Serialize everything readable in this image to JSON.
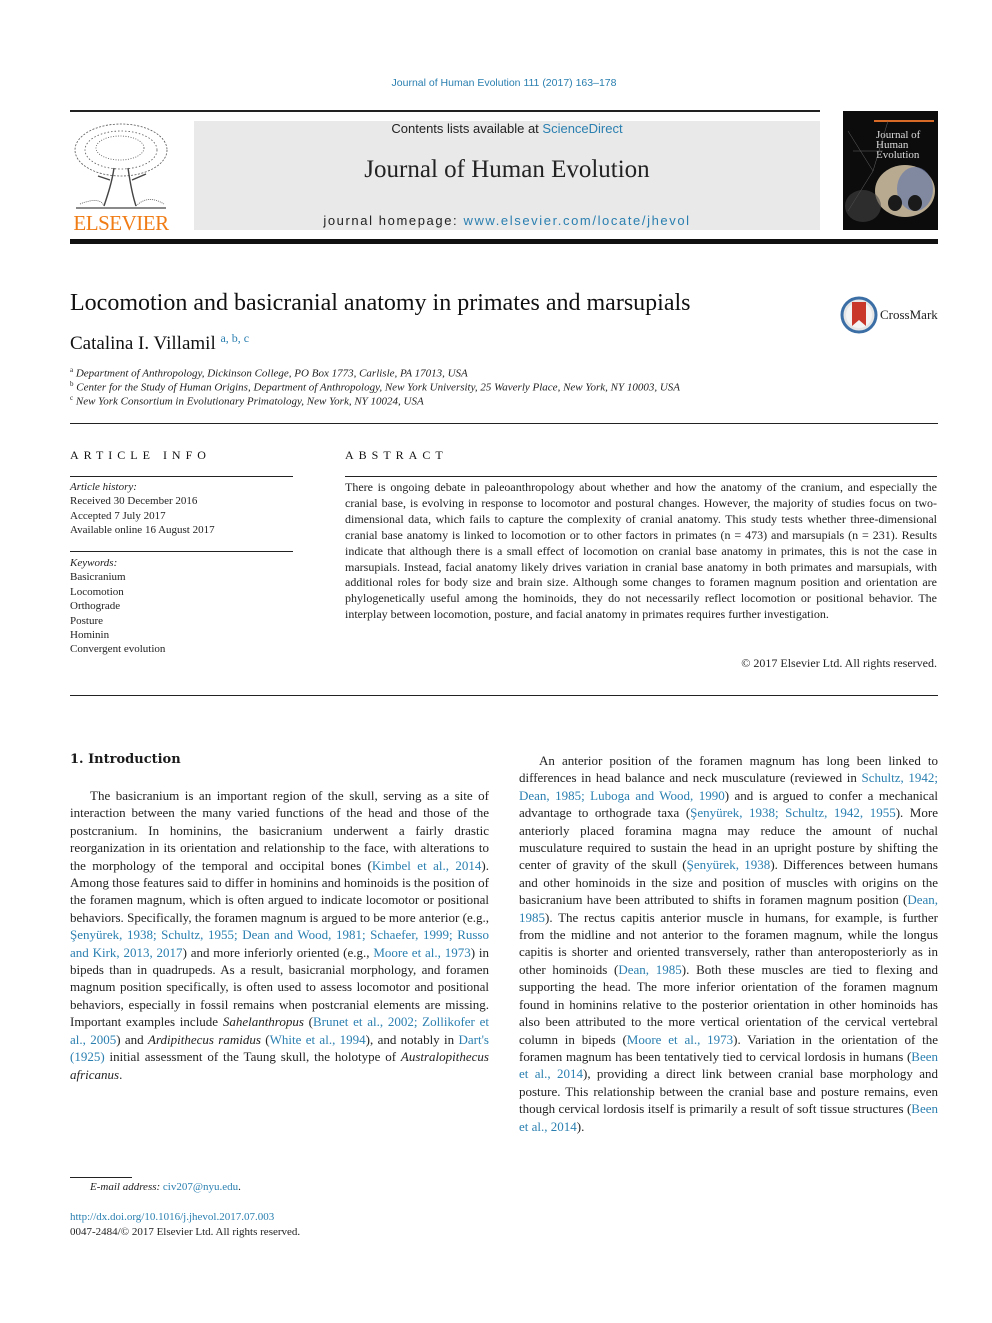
{
  "header": {
    "journal_ref": "Journal of Human Evolution 111 (2017) 163–178",
    "contents_prefix": "Contents lists available at ",
    "contents_link": "ScienceDirect",
    "journal_title": "Journal of Human Evolution",
    "homepage_prefix": "journal homepage: ",
    "homepage_link": "www.elsevier.com/locate/jhevol",
    "publisher_logo": "ELSEVIER",
    "cover_title": "Journal of Human Evolution"
  },
  "article": {
    "title": "Locomotion and basicranial anatomy in primates and marsupials",
    "crossmark_label": "CrossMark",
    "author": "Catalina I. Villamil",
    "author_sups": "a, b, c",
    "affiliations": [
      {
        "sup": "a",
        "text": "Department of Anthropology, Dickinson College, PO Box 1773, Carlisle, PA 17013, USA"
      },
      {
        "sup": "b",
        "text": "Center for the Study of Human Origins, Department of Anthropology, New York University, 25 Waverly Place, New York, NY 10003, USA"
      },
      {
        "sup": "c",
        "text": "New York Consortium in Evolutionary Primatology, New York, NY 10024, USA"
      }
    ]
  },
  "article_info": {
    "heading": "ARTICLE INFO",
    "history_label": "Article history:",
    "history": [
      "Received 30 December 2016",
      "Accepted 7 July 2017",
      "Available online 16 August 2017"
    ],
    "keywords_label": "Keywords:",
    "keywords": [
      "Basicranium",
      "Locomotion",
      "Orthograde",
      "Posture",
      "Hominin",
      "Convergent evolution"
    ]
  },
  "abstract": {
    "heading": "ABSTRACT",
    "text": "There is ongoing debate in paleoanthropology about whether and how the anatomy of the cranium, and especially the cranial base, is evolving in response to locomotor and postural changes. However, the majority of studies focus on two-dimensional data, which fails to capture the complexity of cranial anatomy. This study tests whether three-dimensional cranial base anatomy is linked to locomotion or to other factors in primates (n = 473) and marsupials (n = 231). Results indicate that although there is a small effect of locomotion on cranial base anatomy in primates, this is not the case in marsupials. Instead, facial anatomy likely drives variation in cranial base anatomy in both primates and marsupials, with additional roles for body size and brain size. Although some changes to foramen magnum position and orientation are phylogenetically useful among the hominoids, they do not necessarily reflect locomotion or positional behavior. The interplay between locomotion, posture, and facial anatomy in primates requires further investigation.",
    "copyright": "© 2017 Elsevier Ltd. All rights reserved."
  },
  "intro": {
    "heading": "1.  Introduction",
    "col1": [
      {
        "t": "The basicranium is an important region of the skull, serving as a site of interaction between the many varied functions of the head and those of the postcranium. In hominins, the basicranium underwent a fairly drastic reorganization in its orientation and relationship to the face, with alterations to the morphology of the temporal and occipital bones ("
      },
      {
        "l": "Kimbel et al., 2014"
      },
      {
        "t": "). Among those features said to differ in hominins and hominoids is the position of the foramen magnum, which is often argued to indicate locomotor or positional behaviors. Specifically, the foramen magnum is argued to be more anterior (e.g., "
      },
      {
        "l": "Şenyürek, 1938; Schultz, 1955; Dean and Wood, 1981; Schaefer, 1999; Russo and Kirk, 2013, 2017"
      },
      {
        "t": ") and more inferiorly oriented (e.g., "
      },
      {
        "l": "Moore et al., 1973"
      },
      {
        "t": ") in bipeds than in quadrupeds. As a result, basicranial morphology, and foramen magnum position specifically, is often used to assess locomotor and positional behaviors, especially in fossil remains when postcranial elements are missing. Important examples include "
      },
      {
        "i": "Sahelanthropus"
      },
      {
        "t": " ("
      },
      {
        "l": "Brunet et al., 2002; Zollikofer et al., 2005"
      },
      {
        "t": ") and "
      },
      {
        "i": "Ardipithecus ramidus"
      },
      {
        "t": " ("
      },
      {
        "l": "White et al., 1994"
      },
      {
        "t": "), and notably in "
      },
      {
        "l": "Dart's (1925)"
      },
      {
        "t": " initial assessment of the Taung skull, the holotype of "
      },
      {
        "i": "Australopithecus africanus"
      },
      {
        "t": "."
      }
    ],
    "col2": [
      {
        "t": "An anterior position of the foramen magnum has long been linked to differences in head balance and neck musculature (reviewed in "
      },
      {
        "l": "Schultz, 1942; Dean, 1985; Luboga and Wood, 1990"
      },
      {
        "t": ") and is argued to confer a mechanical advantage to orthograde taxa ("
      },
      {
        "l": "Şenyürek, 1938; Schultz, 1942, 1955"
      },
      {
        "t": "). More anteriorly placed foramina magna may reduce the amount of nuchal musculature required to sustain the head in an upright posture by shifting the center of gravity of the skull ("
      },
      {
        "l": "Şenyürek, 1938"
      },
      {
        "t": "). Differences between humans and other hominoids in the size and position of muscles with origins on the basicranium have been attributed to shifts in foramen magnum position ("
      },
      {
        "l": "Dean, 1985"
      },
      {
        "t": "). The rectus capitis anterior muscle in humans, for example, is further from the midline and not anterior to the foramen magnum, while the longus capitis is shorter and oriented transversely, rather than anteroposteriorly as in other hominoids ("
      },
      {
        "l": "Dean, 1985"
      },
      {
        "t": "). Both these muscles are tied to flexing and supporting the head. The more inferior orientation of the foramen magnum found in hominins relative to the posterior orientation in other hominoids has also been attributed to the more vertical orientation of the cervical vertebral column in bipeds ("
      },
      {
        "l": "Moore et al., 1973"
      },
      {
        "t": "). Variation in the orientation of the foramen magnum has been tentatively tied to cervical lordosis in humans ("
      },
      {
        "l": "Been et al., 2014"
      },
      {
        "t": "), providing a direct link between cranial base morphology and posture. This relationship between the cranial base and posture remains, even though cervical lordosis itself is primarily a result of soft tissue structures ("
      },
      {
        "l": "Been et al., 2014"
      },
      {
        "t": ")."
      }
    ]
  },
  "footer": {
    "email_label": "E-mail address: ",
    "email": "civ207@nyu.edu",
    "doi": "http://dx.doi.org/10.1016/j.jhevol.2017.07.003",
    "issn": "0047-2484/© 2017 Elsevier Ltd. All rights reserved."
  }
}
